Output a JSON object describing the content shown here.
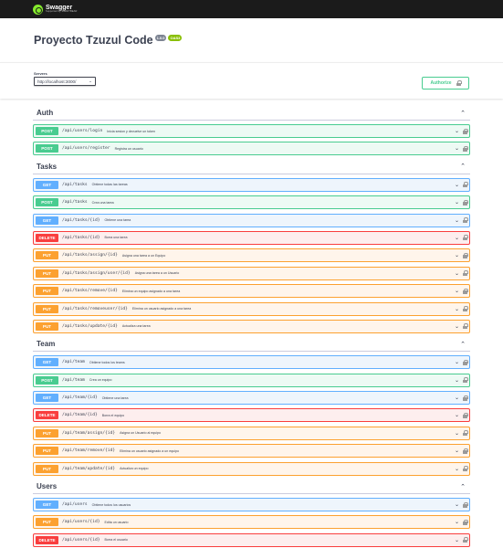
{
  "topbar": {
    "logo_name": "Swagger",
    "logo_sub": "Supported by SMARTBEAR"
  },
  "info": {
    "title": "Proyecto Tzuzul Code",
    "version_badge": "1.0.0",
    "oas_badge": "OAS3"
  },
  "scheme": {
    "servers_label": "Servers",
    "server_value": "http://localhost:3000/",
    "authorize_label": "Authorize"
  },
  "colors": {
    "post": "#49cc90",
    "get": "#61affe",
    "delete": "#f93e3e",
    "put": "#fca130"
  },
  "sections": [
    {
      "name": "Auth",
      "operations": [
        {
          "method": "POST",
          "path": "/api/users/login",
          "summary": "Inicia sesion y devuelve un token"
        },
        {
          "method": "POST",
          "path": "/api/users/register",
          "summary": "Registra un usuario"
        }
      ]
    },
    {
      "name": "Tasks",
      "operations": [
        {
          "method": "GET",
          "path": "/api/tasks",
          "summary": "Obtiene todas las tareas"
        },
        {
          "method": "POST",
          "path": "/api/tasks",
          "summary": "Crea una tarea"
        },
        {
          "method": "GET",
          "path": "/api/tasks/{id}",
          "summary": "Obtiene una tarea"
        },
        {
          "method": "DELETE",
          "path": "/api/tasks/{id}",
          "summary": "Borra una tarea"
        },
        {
          "method": "PUT",
          "path": "/api/tasks/assign/{id}",
          "summary": "Asigna una tarea a un Equipo"
        },
        {
          "method": "PUT",
          "path": "/api/tasks/assign/user/{id}",
          "summary": "Asigna una tarea a un Usuario"
        },
        {
          "method": "PUT",
          "path": "/api/tasks/remove/{id}",
          "summary": "Elimina un equipo asignado a una tarea"
        },
        {
          "method": "PUT",
          "path": "/api/tasks/removeuser/{id}",
          "summary": "Elimina un usuario asignado a una tarea"
        },
        {
          "method": "PUT",
          "path": "/api/tasks/update/{id}",
          "summary": "Actualiza una tarea"
        }
      ]
    },
    {
      "name": "Team",
      "operations": [
        {
          "method": "GET",
          "path": "/api/team",
          "summary": "Obtiene todos los teams"
        },
        {
          "method": "POST",
          "path": "/api/team",
          "summary": "Crea un equipo"
        },
        {
          "method": "GET",
          "path": "/api/team/{id}",
          "summary": "Obtiene una tarea"
        },
        {
          "method": "DELETE",
          "path": "/api/team/{id}",
          "summary": "Borra el equipo"
        },
        {
          "method": "PUT",
          "path": "/api/team/assign/{id}",
          "summary": "Asigna un Usuario al equipo"
        },
        {
          "method": "PUT",
          "path": "/api/team/remove/{id}",
          "summary": "Elimina un usuario asignado a un equipo"
        },
        {
          "method": "PUT",
          "path": "/api/team/update/{id}",
          "summary": "Actualiza un equipo"
        }
      ]
    },
    {
      "name": "Users",
      "operations": [
        {
          "method": "GET",
          "path": "/api/users",
          "summary": "Obtiene todos los usuarios"
        },
        {
          "method": "PUT",
          "path": "/api/users/{id}",
          "summary": "Edita un usuario"
        },
        {
          "method": "DELETE",
          "path": "/api/users/{id}",
          "summary": "Borra el usuario"
        }
      ]
    }
  ]
}
